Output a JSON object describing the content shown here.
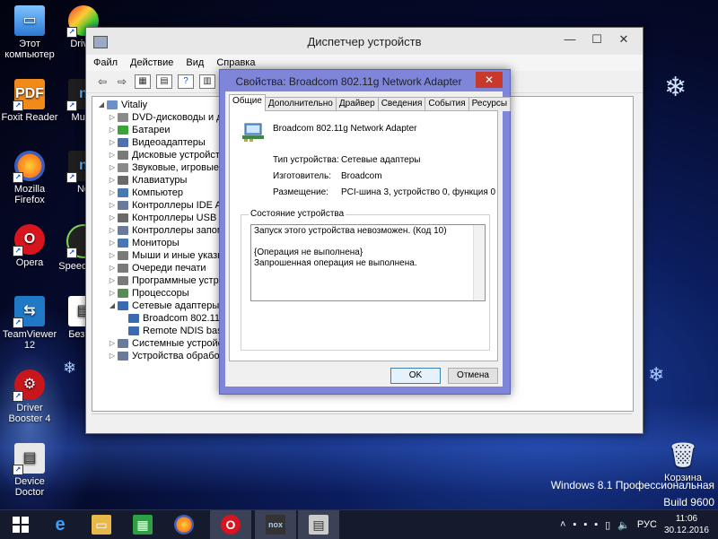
{
  "desktop": {
    "icons": [
      {
        "label": "Этот компьютер",
        "id": "this-pc"
      },
      {
        "label": "Foxit Reader",
        "id": "foxit"
      },
      {
        "label": "Mozilla Firefox",
        "id": "firefox"
      },
      {
        "label": "Opera",
        "id": "opera"
      },
      {
        "label": "TeamViewer 12",
        "id": "teamviewer"
      },
      {
        "label": "Driver Booster 4",
        "id": "driverbooster"
      },
      {
        "label": "Device Doctor",
        "id": "devicedoctor"
      },
      {
        "label": "Driver",
        "id": "driver"
      },
      {
        "label": "Multi-",
        "id": "multi"
      },
      {
        "label": "No",
        "id": "no"
      },
      {
        "label": "Speed This",
        "id": "speed"
      },
      {
        "label": "Безым",
        "id": "bezym"
      },
      {
        "label": "Корзина",
        "id": "recycle"
      }
    ],
    "watermark_line1": "Windows 8.1 Профессиональная",
    "watermark_line2": "Build 9600"
  },
  "device_manager": {
    "title": "Диспетчер устройств",
    "menu": [
      "Файл",
      "Действие",
      "Вид",
      "Справка"
    ],
    "tree_root": "Vitaliy",
    "tree": [
      {
        "label": "DVD-дисководы и дис",
        "expanded": false,
        "indent": 1,
        "color": "#8a8a8a"
      },
      {
        "label": "Батареи",
        "expanded": false,
        "indent": 1,
        "color": "#3aa33a"
      },
      {
        "label": "Видеоадаптеры",
        "expanded": false,
        "indent": 1,
        "color": "#5070b0"
      },
      {
        "label": "Дисковые устройства",
        "expanded": false,
        "indent": 1,
        "color": "#7a7a7a"
      },
      {
        "label": "Звуковые, игровые и",
        "expanded": false,
        "indent": 1,
        "color": "#8a8a8a"
      },
      {
        "label": "Клавиатуры",
        "expanded": false,
        "indent": 1,
        "color": "#6a6a6a"
      },
      {
        "label": "Компьютер",
        "expanded": false,
        "indent": 1,
        "color": "#4a78b0"
      },
      {
        "label": "Контроллеры IDE ATA",
        "expanded": false,
        "indent": 1,
        "color": "#6a7a9a"
      },
      {
        "label": "Контроллеры USB",
        "expanded": false,
        "indent": 1,
        "color": "#6a6a6a"
      },
      {
        "label": "Контроллеры запомi",
        "expanded": false,
        "indent": 1,
        "color": "#6a7a9a"
      },
      {
        "label": "Мониторы",
        "expanded": false,
        "indent": 1,
        "color": "#4a78b0"
      },
      {
        "label": "Мыши и иные указы",
        "expanded": false,
        "indent": 1,
        "color": "#7a7a7a"
      },
      {
        "label": "Очереди печати",
        "expanded": false,
        "indent": 1,
        "color": "#7a7a7a"
      },
      {
        "label": "Программные устро",
        "expanded": false,
        "indent": 1,
        "color": "#7a7a7a"
      },
      {
        "label": "Процессоры",
        "expanded": false,
        "indent": 1,
        "color": "#5a8a5a"
      },
      {
        "label": "Сетевые адаптеры",
        "expanded": true,
        "indent": 1,
        "color": "#3a6ab0"
      },
      {
        "label": "Broadcom 802.11g",
        "expanded": null,
        "indent": 2,
        "color": "#3a6ab0"
      },
      {
        "label": "Remote NDIS based",
        "expanded": null,
        "indent": 2,
        "color": "#3a6ab0"
      },
      {
        "label": "Системные устройст",
        "expanded": false,
        "indent": 1,
        "color": "#6a7a9a"
      },
      {
        "label": "Устройства обработк",
        "expanded": false,
        "indent": 1,
        "color": "#6a7a9a"
      }
    ]
  },
  "properties_dialog": {
    "title": "Свойства: Broadcom 802.11g Network Adapter",
    "tabs": [
      "Общие",
      "Дополнительно",
      "Драйвер",
      "Сведения",
      "События",
      "Ресурсы"
    ],
    "device_name": "Broadcom 802.11g Network Adapter",
    "props": {
      "type_label": "Тип устройства:",
      "type_value": "Сетевые адаптеры",
      "maker_label": "Изготовитель:",
      "maker_value": "Broadcom",
      "location_label": "Размещение:",
      "location_value": "PCI-шина 3, устройство 0, функция 0"
    },
    "status_legend": "Состояние устройства",
    "status_lines": [
      "Запуск этого устройства невозможен. (Код 10)",
      "",
      "{Операция не выполнена}",
      "Запрошенная операция не выполнена."
    ],
    "ok": "OK",
    "cancel": "Отмена"
  },
  "taskbar": {
    "lang": "РУС",
    "time": "11:06",
    "date": "30.12.2016"
  }
}
